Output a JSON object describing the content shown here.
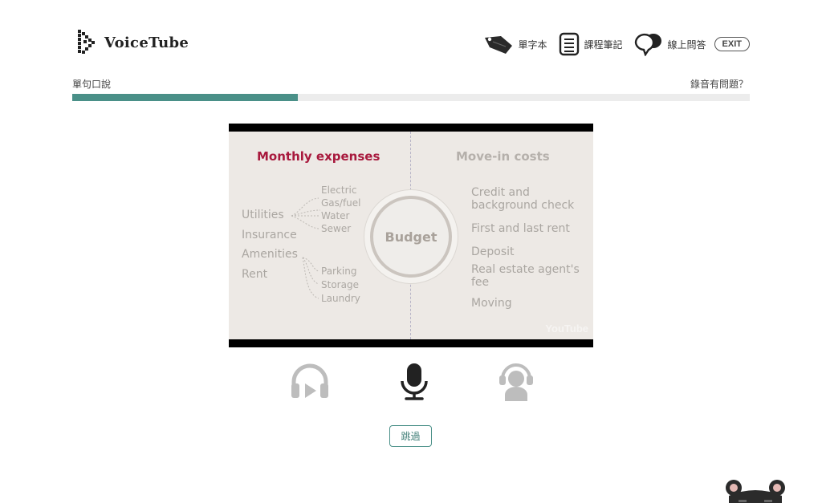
{
  "app": {
    "name": "VoiceTube"
  },
  "nav": {
    "vocab_label": "單字本",
    "notes_label": "課程筆記",
    "qa_label": "線上問答",
    "exit_label": "EXIT"
  },
  "progress": {
    "mode_label": "單句口說",
    "issue_label": "錄音有問題？",
    "value": 0.333,
    "color": "#4a9088"
  },
  "video": {
    "left_heading": "Monthly expenses",
    "right_heading": "Move-in costs",
    "center_label": "Budget",
    "left_items": [
      "Utilities",
      "Insurance",
      "Amenities",
      "Rent"
    ],
    "utilities_sub": [
      "Electric",
      "Gas/fuel",
      "Water",
      "Sewer"
    ],
    "amenities_sub": [
      "Parking",
      "Storage",
      "Laundry"
    ],
    "right_items": [
      "Credit and background check",
      "First and last rent",
      "Deposit",
      "Real estate agent's fee",
      "Moving"
    ],
    "watermark": "YouTube",
    "accent_color": "#a8193d"
  },
  "steps": [
    {
      "icon": "headphones-play-icon",
      "state": "inactive"
    },
    {
      "icon": "microphone-icon",
      "state": "active"
    },
    {
      "icon": "listener-icon",
      "state": "inactive"
    }
  ],
  "skip_label": "跳過"
}
